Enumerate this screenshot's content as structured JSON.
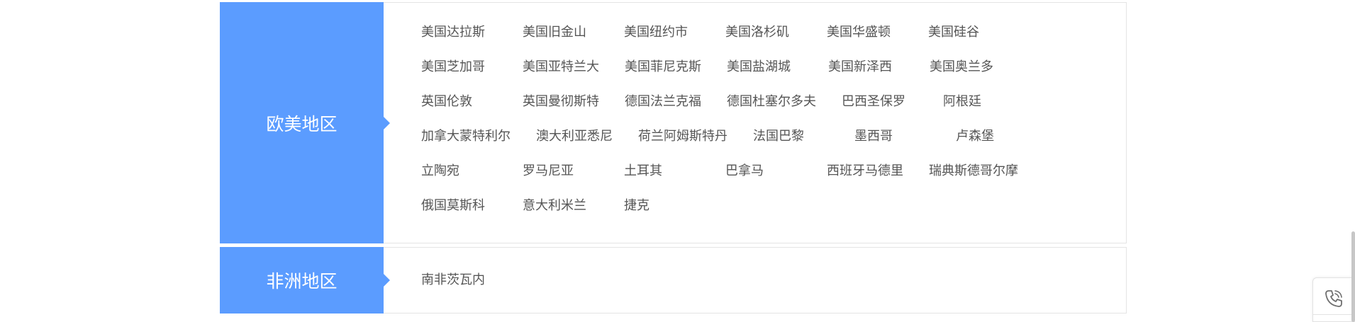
{
  "regions": [
    {
      "label": "欧美地区",
      "cities": [
        "美国达拉斯",
        "美国旧金山",
        "美国纽约市",
        "美国洛杉矶",
        "美国华盛顿",
        "美国硅谷",
        "美国芝加哥",
        "美国亚特兰大",
        "美国菲尼克斯",
        "美国盐湖城",
        "美国新泽西",
        "美国奥兰多",
        "英国伦敦",
        "英国曼彻斯特",
        "德国法兰克福",
        "德国杜塞尔多夫",
        "巴西圣保罗",
        "阿根廷",
        "加拿大蒙特利尔",
        "澳大利亚悉尼",
        "荷兰阿姆斯特丹",
        "法国巴黎",
        "墨西哥",
        "卢森堡",
        "立陶宛",
        "罗马尼亚",
        "土耳其",
        "巴拿马",
        "西班牙马德里",
        "瑞典斯德哥尔摩",
        "俄国莫斯科",
        "意大利米兰",
        "捷克"
      ]
    },
    {
      "label": "非洲地区",
      "cities": [
        "南非茨瓦内"
      ]
    }
  ],
  "side_widget": {
    "icon": "phone-icon"
  },
  "colors": {
    "accent": "#5b9cff",
    "text": "#555555",
    "border": "#e4e4e4"
  }
}
